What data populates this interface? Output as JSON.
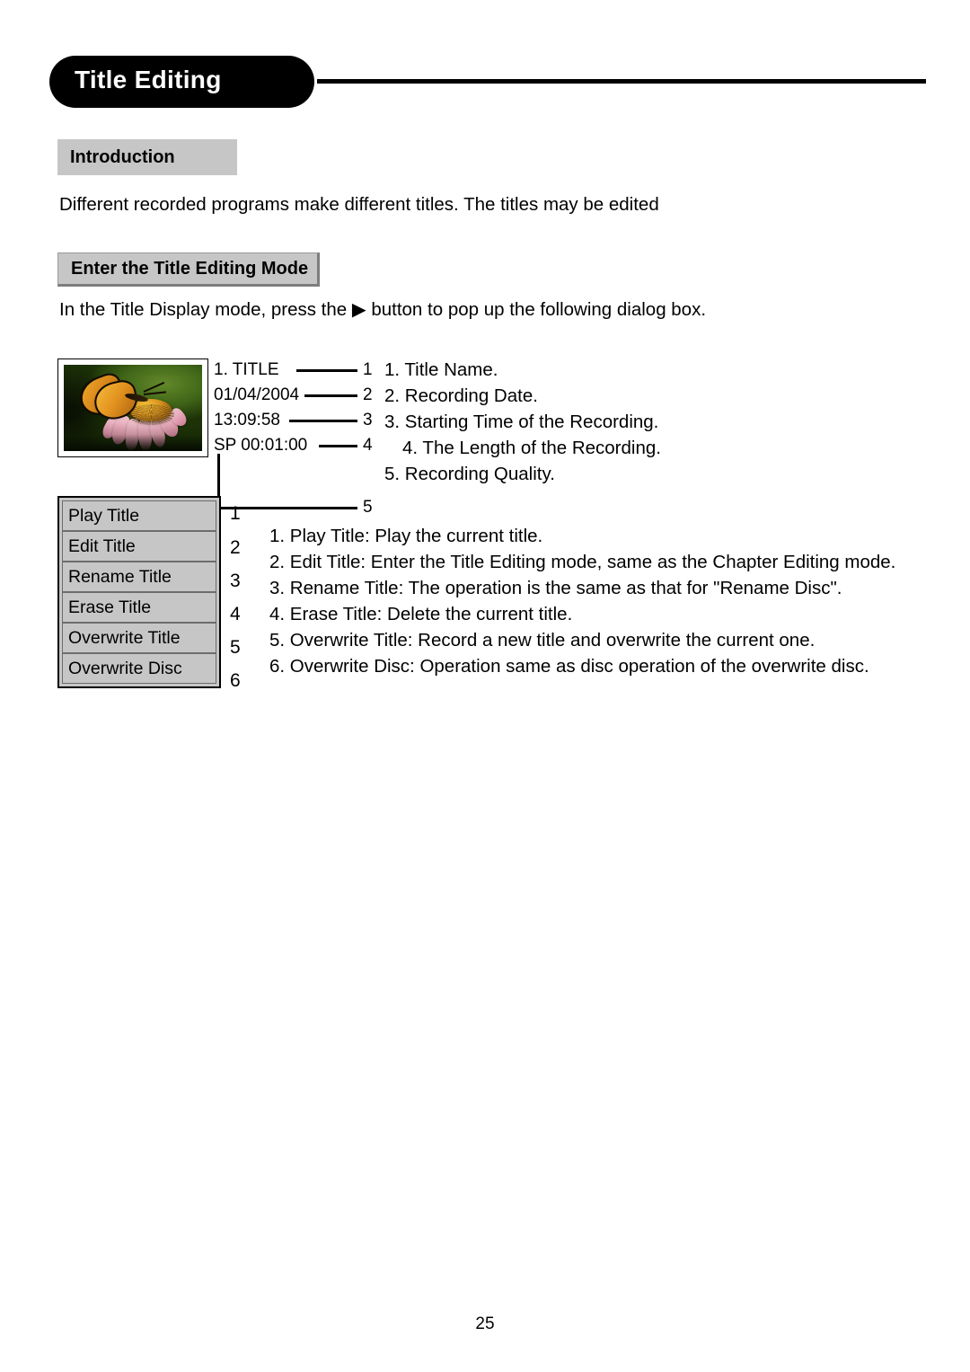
{
  "header": {
    "title": "Title Editing"
  },
  "sections": {
    "introduction": {
      "heading": "Introduction",
      "paragraph": "Different recorded programs make different titles. The titles may be edited"
    },
    "enter_mode": {
      "heading": "Enter the Title Editing Mode",
      "paragraph": "In the Title Display mode, press the ▶ button to pop up the following dialog box."
    }
  },
  "osd_dialog": {
    "thumbnail_alt": "butterfly-on-coneflower-thumbnail",
    "metadata": [
      {
        "text": "1. TITLE",
        "callout": "1"
      },
      {
        "text": "01/04/2004",
        "callout": "2"
      },
      {
        "text": "13:09:58",
        "callout": "3"
      },
      {
        "text": "SP 00:01:00",
        "callout": "4"
      },
      {
        "text": "",
        "callout": "5"
      }
    ],
    "legend": [
      "1. Title Name.",
      "2. Recording Date.",
      "3. Starting Time of the Recording.",
      "4. The Length of the Recording.",
      "5. Recording Quality."
    ]
  },
  "menu": {
    "items": [
      {
        "label": "Play Title",
        "number": "1"
      },
      {
        "label": "Edit Title",
        "number": "2"
      },
      {
        "label": "Rename Title",
        "number": "3"
      },
      {
        "label": "Erase Title",
        "number": "4"
      },
      {
        "label": "Overwrite Title",
        "number": "5"
      },
      {
        "label": "Overwrite Disc",
        "number": "6"
      }
    ],
    "descriptions": [
      "1. Play Title: Play the current title.",
      "2. Edit Title: Enter the Title Editing mode, same as the Chapter Editing mode.",
      "3. Rename Title: The operation is the same as that for \"Rename Disc\".",
      "4. Erase Title: Delete the current title.",
      "5. Overwrite Title: Record a new title and overwrite the current one.",
      "6. Overwrite Disc: Operation same as disc operation of the overwrite disc."
    ]
  },
  "footer": {
    "page_number": "25"
  },
  "colors": {
    "heading_fill": "#c6c6c6",
    "menu_fill": "#c6c6c6",
    "rule": "#000000",
    "pill": "#000000"
  }
}
